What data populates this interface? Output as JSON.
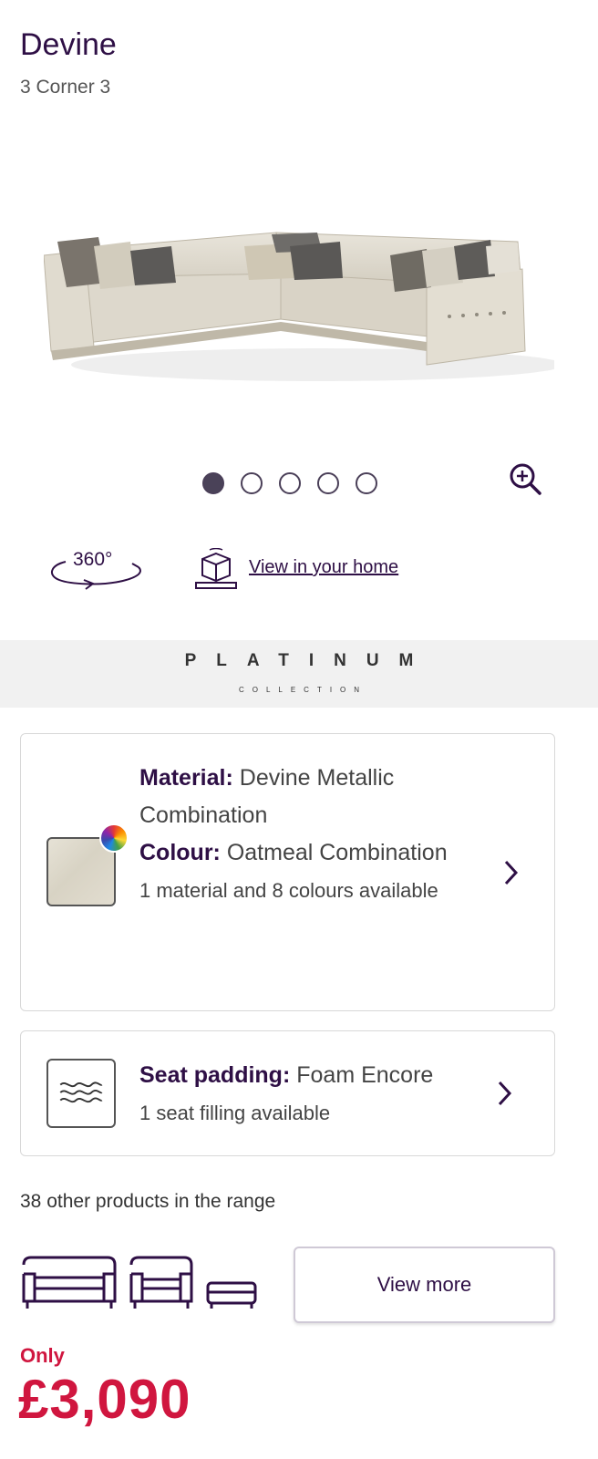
{
  "product": {
    "name": "Devine",
    "variant": "3 Corner 3"
  },
  "gallery": {
    "total_images": 5,
    "active_index": 0
  },
  "actions": {
    "spin_label": "360°",
    "ar_label": "View in your home"
  },
  "collection": {
    "name": "PLATINUM",
    "subtitle": "COLLECTION"
  },
  "material_card": {
    "material_label": "Material:",
    "material_value": "Devine Metallic Combination",
    "colour_label": "Colour:",
    "colour_value": "Oatmeal Combination",
    "availability": "1 material and 8 colours available"
  },
  "padding_card": {
    "label": "Seat padding:",
    "value": "Foam Encore",
    "availability": "1 seat filling available"
  },
  "range": {
    "text": "38 other products in the range",
    "button": "View more"
  },
  "price": {
    "prefix": "Only",
    "value": "£3,090"
  },
  "colors": {
    "brand": "#2e0f45",
    "price": "#d0163f",
    "banner_bg": "#f1f1f1"
  }
}
